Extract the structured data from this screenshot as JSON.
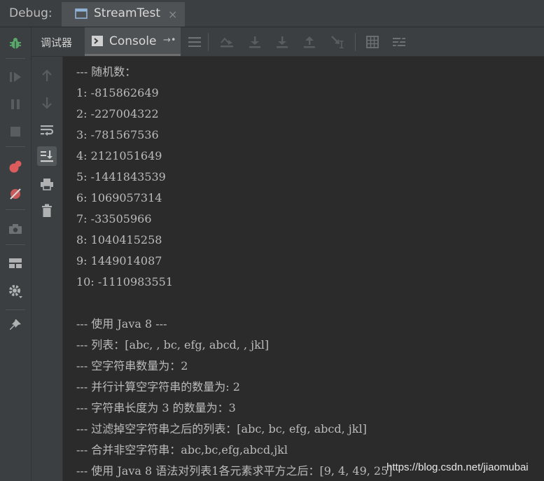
{
  "header": {
    "debug_label": "Debug:",
    "run_tab_title": "StreamTest",
    "close_glyph": "×"
  },
  "toolbar": {
    "debugger_tab_label": "调试器",
    "console_tab_label": "Console",
    "console_pin_glyph": "→•"
  },
  "console": {
    "lines": [
      "--- 随机数：",
      "1: -815862649",
      "2: -227004322",
      "3: -781567536",
      "4: 2121051649",
      "5: -1441843539",
      "6: 1069057314",
      "7: -33505966",
      "8: 1040415258",
      "9: 1449014087",
      "10: -1110983551",
      "",
      "--- 使用 Java 8 ---",
      "--- 列表：[abc, , bc, efg, abcd, , jkl]",
      "--- 空字符串数量为：2",
      "--- 并行计算空字符串的数量为: 2",
      "--- 字符串长度为 3 的数量为：3",
      "--- 过滤掉空字符串之后的列表：[abc, bc, efg, abcd, jkl]",
      "--- 合并非空字符串：abc,bc,efg,abcd,jkl",
      "--- 使用 Java 8 语法对列表1各元素求平方之后：[9, 4, 49, 25]"
    ]
  },
  "watermark": "https://blog.csdn.net/jiaomubai",
  "icons": {
    "left_toolbar": [
      "bug-icon",
      "resume-icon",
      "pause-icon",
      "stop-icon",
      "view-breakpoints-icon",
      "mute-breakpoints-icon",
      "camera-icon",
      "layout-icon",
      "settings-icon",
      "pin-icon"
    ],
    "sub_toolbar": [
      "console-icon",
      "menu-icon",
      "show-execution-point-icon",
      "step-over-icon",
      "step-into-icon",
      "step-out-icon",
      "run-to-cursor-icon",
      "evaluate-icon",
      "trace-icon"
    ],
    "console_side": [
      "up-arrow-icon",
      "down-arrow-icon",
      "soft-wrap-icon",
      "scroll-to-end-icon",
      "print-icon",
      "trash-icon"
    ]
  },
  "colors": {
    "bug_green": "#59a869",
    "breakpoint_red": "#db5c5c",
    "text": "#bbbbbb"
  }
}
